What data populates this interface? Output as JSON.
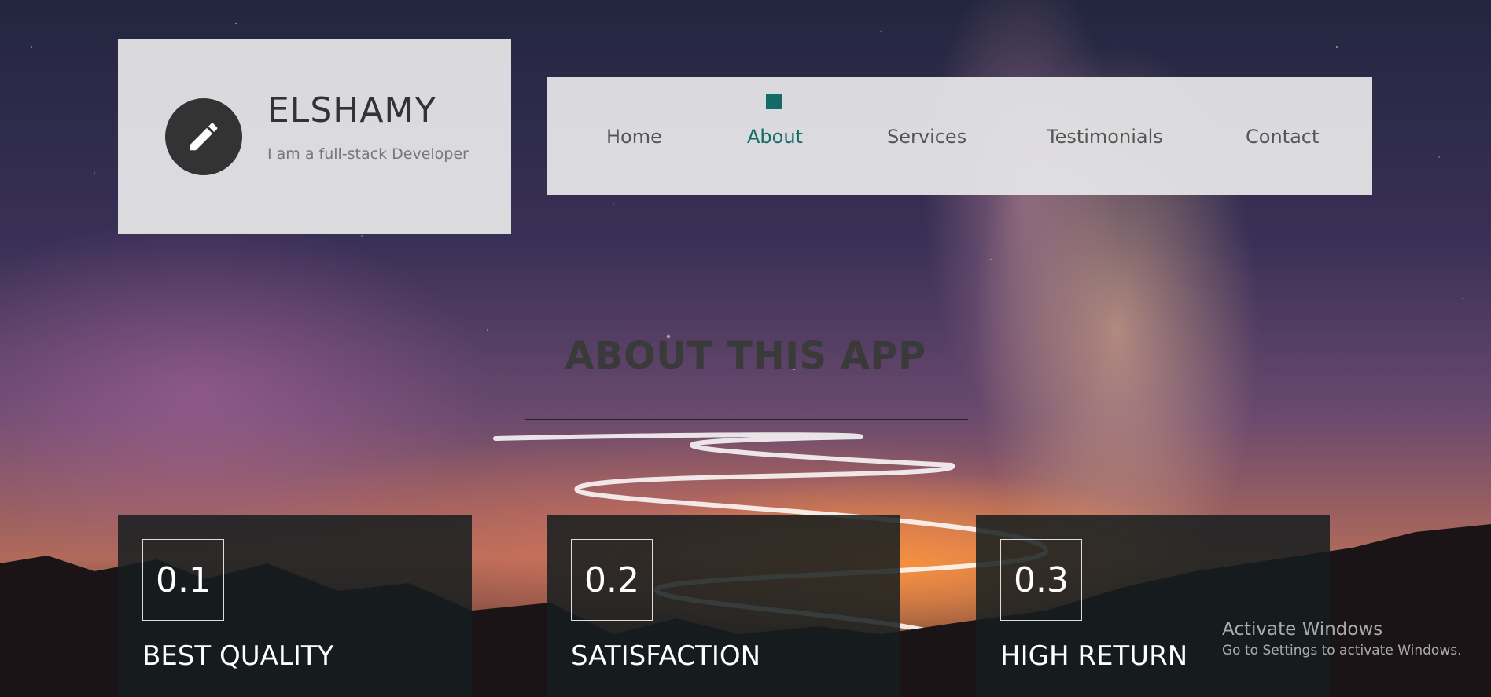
{
  "brand": {
    "name": "ELSHAMY",
    "tagline": "I am a full-stack Developer",
    "icon": "pencil-icon"
  },
  "nav": {
    "items": [
      {
        "label": "Home",
        "active": false
      },
      {
        "label": "About",
        "active": true
      },
      {
        "label": "Services",
        "active": false
      },
      {
        "label": "Testimonials",
        "active": false
      },
      {
        "label": "Contact",
        "active": false
      }
    ]
  },
  "about": {
    "title": "ABOUT THIS APP"
  },
  "features": [
    {
      "number": "0.1",
      "title": "BEST QUALITY"
    },
    {
      "number": "0.2",
      "title": "SATISFACTION"
    },
    {
      "number": "0.3",
      "title": "HIGH RETURN"
    }
  ],
  "watermark": {
    "title": "Activate Windows",
    "subtitle": "Go to Settings to activate Windows."
  },
  "colors": {
    "accent": "#126b66",
    "panel": "#e2e2e4",
    "card": "#161e20"
  }
}
